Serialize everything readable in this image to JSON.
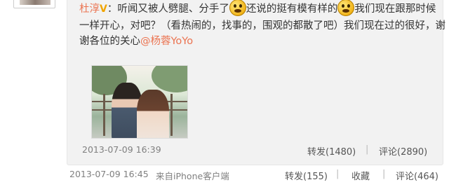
{
  "retweet": {
    "author": "杜淳",
    "text_line1a": "：听闻又被人劈腿、分手了",
    "text_line1b": "还说的挺有模有样的",
    "text_line1c": "我们现在跟那时候",
    "text_line2": "一样开心，对吧？（看热闹的，找事的，围观的都散了吧）我们现在过的很好，谢",
    "text_line3_prefix": "谢各位的关心",
    "mention": "@杨蓉YoYo",
    "time": "2013-07-09 16:39",
    "repost_label": "转发(1480)",
    "comment_label": "评论(2890)"
  },
  "post_footer": {
    "time": "2013-07-09 16:45",
    "source": "来自iPhone客户端",
    "repost_label": "转发(155)",
    "favorite_label": "收藏",
    "comment_label": "评论(464)"
  },
  "colors": {
    "name": "#eb7350",
    "mention": "#eb7350",
    "box_bg": "#f2f2f2"
  },
  "icons": [
    "verified-v-icon",
    "emoji-face-icon"
  ]
}
